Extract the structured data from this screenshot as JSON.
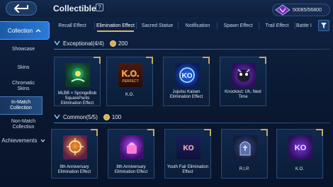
{
  "header": {
    "title": "Collectible",
    "help_icon": "?",
    "currency_value": "50085/56800"
  },
  "tabs": [
    {
      "label": "Recall Effect"
    },
    {
      "label": "Elimination Effect"
    },
    {
      "label": "Sacred Statue"
    },
    {
      "label": "Notification"
    },
    {
      "label": "Spawn Effect"
    },
    {
      "label": "Trail Effect"
    },
    {
      "label": "Battle I"
    }
  ],
  "sidebar": {
    "collection": "Collection",
    "items": [
      {
        "label": "Showcase"
      },
      {
        "label": "Skins"
      },
      {
        "label": "Chromatic\nSkins"
      },
      {
        "label": "In-Match\nCollection"
      },
      {
        "label": "Non-Match\nCollection"
      },
      {
        "label": "Achievements"
      }
    ]
  },
  "sections": [
    {
      "title": "Exceptional(4/4)",
      "points": "200",
      "cards": [
        {
          "label": "MLBB × SpongeBob SquarePants Elimination Effect",
          "art": "spongebob"
        },
        {
          "label": "K.O.",
          "art": "ko-perfect"
        },
        {
          "label": "Jujutsu Kaisen Elimination Effect",
          "art": "jujutsu"
        },
        {
          "label": "Knockout: Uh, Next Time",
          "art": "knockout"
        }
      ]
    },
    {
      "title": "Common(5/5)",
      "points": "100",
      "cards": [
        {
          "label": "9th Anniversary Elimination Effect",
          "art": "9th"
        },
        {
          "label": "8th Anniversary Elimination Effect",
          "art": "8th"
        },
        {
          "label": "Youth Fair Elimination Effect",
          "art": "youth"
        },
        {
          "label": "R.I.P.",
          "art": "rip"
        },
        {
          "label": "K.O.",
          "art": "ko"
        }
      ]
    }
  ],
  "colors": {
    "accent": "#2a7bd8",
    "gold": "#d6b050",
    "background": "#0c1a33"
  }
}
